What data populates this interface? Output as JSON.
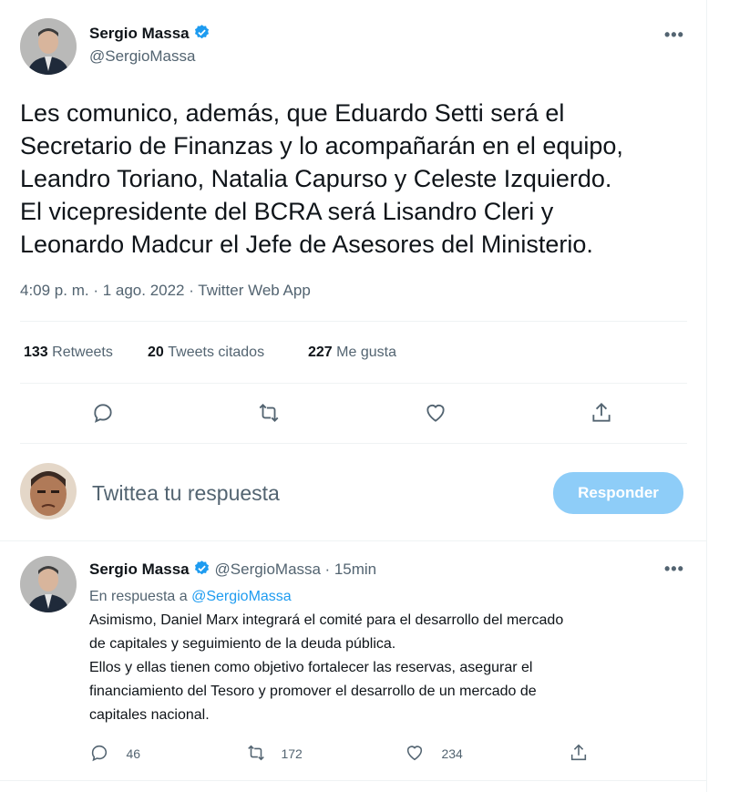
{
  "main_tweet": {
    "author_name": "Sergio Massa",
    "author_handle": "@SergioMassa",
    "more": "•••",
    "lines": [
      "Les comunico, además, que Eduardo Setti será el",
      "Secretario de Finanzas y lo acompañarán en el equipo,",
      "Leandro Toriano, Natalia Capurso y Celeste Izquierdo.",
      "El vicepresidente del BCRA será Lisandro Cleri y",
      "Leonardo Madcur el Jefe de Asesores del Ministerio."
    ],
    "timestamp": "4:09 p. m. · 1 ago. 2022 · Twitter Web App",
    "stats": {
      "retweets": "133",
      "retweets_label": "Retweets",
      "quotes": "20",
      "quotes_label": "Tweets citados",
      "likes": "227",
      "likes_label": "Me gusta"
    }
  },
  "composer": {
    "placeholder": "Twittea tu respuesta",
    "button": "Responder"
  },
  "reply_tweet": {
    "author_name": "Sergio Massa",
    "author_handle": "@SergioMassa",
    "time": "· 15min",
    "more": "•••",
    "in_reply_prefix": "En respuesta a",
    "in_reply_handle": "@SergioMassa",
    "lines": [
      "Asimismo, Daniel Marx integrará el comité para el desarrollo del mercado",
      "de capitales y seguimiento de la deuda pública.",
      "Ellos y ellas tienen como objetivo fortalecer las reservas, asegurar el",
      "financiamiento del Tesoro y promover el desarrollo de un mercado de",
      "capitales nacional."
    ],
    "replies": "46",
    "retweets": "172",
    "likes": "234"
  },
  "icons": {
    "verified": "verified-badge-icon",
    "reply": "reply-icon",
    "retweet": "retweet-icon",
    "like": "heart-icon",
    "share": "share-icon"
  },
  "colors": {
    "accent": "#1d9bf0",
    "button_disabled": "#8ecdf8",
    "muted": "#536471"
  }
}
